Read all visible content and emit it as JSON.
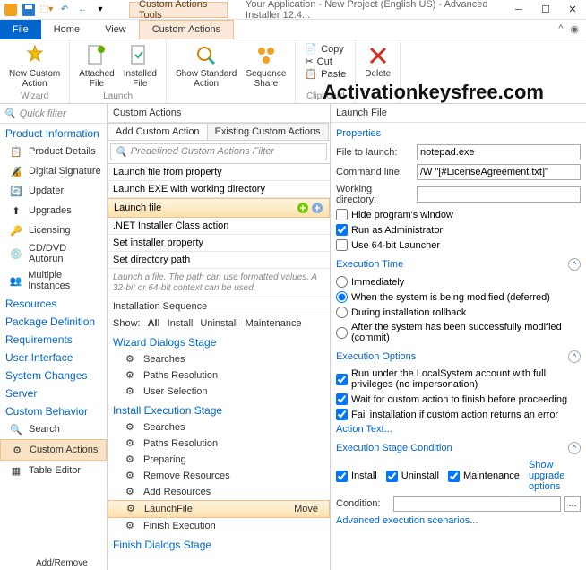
{
  "titlebar": {
    "context_tools": "Custom Actions Tools",
    "title": "Your Application - New Project (English US) - Advanced Installer 12.4..."
  },
  "menus": {
    "file": "File",
    "home": "Home",
    "view": "View",
    "custom_actions": "Custom Actions"
  },
  "ribbon": {
    "new_custom": "New Custom\nAction",
    "attached_file": "Attached\nFile",
    "installed_file": "Installed\nFile",
    "show_standard": "Show Standard\nAction",
    "sequence_share": "Sequence\nShare",
    "copy": "Copy",
    "cut": "Cut",
    "paste": "Paste",
    "delete": "Delete",
    "group_wizard": "Wizard",
    "group_launch": "Launch",
    "group_clipboard": "Clipboard"
  },
  "watermark": "Activationkeysfree.com",
  "nav": {
    "filter_placeholder": "Quick filter",
    "headers": {
      "product_info": "Product Information",
      "resources": "Resources",
      "package_def": "Package Definition",
      "requirements": "Requirements",
      "user_interface": "User Interface",
      "system_changes": "System Changes",
      "server": "Server",
      "custom_behavior": "Custom Behavior"
    },
    "items": {
      "product_details": "Product Details",
      "digital_signature": "Digital Signature",
      "updater": "Updater",
      "upgrades": "Upgrades",
      "licensing": "Licensing",
      "cddvd": "CD/DVD Autorun",
      "multiple_instances": "Multiple Instances",
      "search": "Search",
      "custom_actions": "Custom Actions",
      "table_editor": "Table Editor"
    },
    "footer": "Add/Remove"
  },
  "center": {
    "title": "Custom Actions",
    "tabs": {
      "add": "Add Custom Action",
      "existing": "Existing Custom Actions"
    },
    "search_placeholder": "Predefined Custom Actions Filter",
    "list": [
      "Launch file from property",
      "Launch EXE with working directory",
      "Launch file",
      ".NET Installer Class action",
      "Set installer property",
      "Set directory path"
    ],
    "hint": "Launch a file. The path can use formatted values. A 32-bit or 64-bit context can be used.",
    "seq_title": "Installation Sequence",
    "show_label": "Show:",
    "show_all": "All",
    "show_items": [
      "Install",
      "Uninstall",
      "Maintenance"
    ],
    "stages": {
      "wizard": "Wizard Dialogs Stage",
      "install": "Install Execution Stage",
      "finish": "Finish Dialogs Stage"
    },
    "wizard_items": [
      "Searches",
      "Paths Resolution",
      "User Selection"
    ],
    "install_items": [
      "Searches",
      "Paths Resolution",
      "Preparing",
      "Remove Resources",
      "Add Resources",
      "LaunchFile",
      "Finish Execution"
    ],
    "move": "Move"
  },
  "right": {
    "title": "Launch File",
    "properties": "Properties",
    "file_to_launch_label": "File to launch:",
    "file_to_launch": "notepad.exe",
    "command_line_label": "Command line:",
    "command_line": "/W \"[#LicenseAgreement.txt]\"",
    "working_dir_label": "Working directory:",
    "working_dir": "",
    "hide_window": "Hide program's window",
    "run_admin": "Run as Administrator",
    "use_64bit": "Use 64-bit Launcher",
    "exec_time": "Execution Time",
    "et_immediately": "Immediately",
    "et_deferred": "When the system is being modified (deferred)",
    "et_rollback": "During installation rollback",
    "et_commit": "After the system has been successfully modified (commit)",
    "exec_options": "Execution Options",
    "eo_localsystem": "Run under the LocalSystem account with full privileges (no impersonation)",
    "eo_wait": "Wait for custom action to finish before proceeding",
    "eo_fail": "Fail installation if custom action returns an error",
    "action_text": "Action Text...",
    "exec_stage_cond": "Execution Stage Condition",
    "install": "Install",
    "uninstall": "Uninstall",
    "maintenance": "Maintenance",
    "show_upgrade": "Show upgrade options",
    "condition_label": "Condition:",
    "advanced": "Advanced execution scenarios..."
  }
}
